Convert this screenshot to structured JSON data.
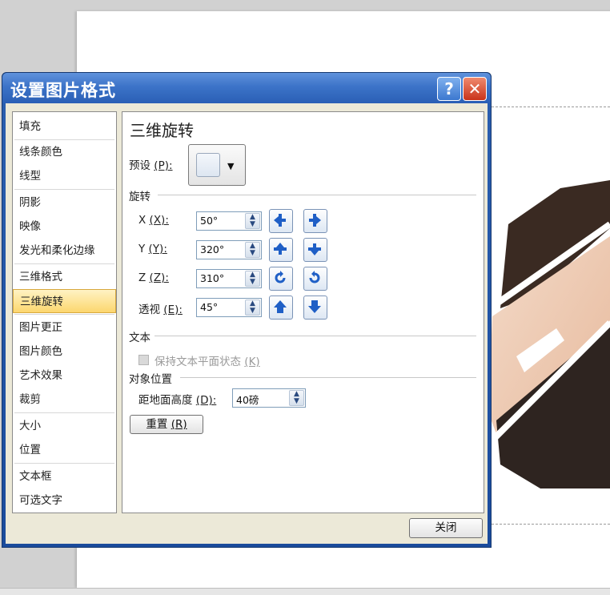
{
  "dialog": {
    "title": "设置图片格式",
    "help_label": "?",
    "close_label": "✕",
    "close_button_label": "关闭"
  },
  "nav": {
    "items": [
      {
        "label": "填充"
      },
      {
        "label": "线条颜色"
      },
      {
        "label": "线型"
      },
      {
        "label": "阴影"
      },
      {
        "label": "映像"
      },
      {
        "label": "发光和柔化边缘"
      },
      {
        "label": "三维格式"
      },
      {
        "label": "三维旋转"
      },
      {
        "label": "图片更正"
      },
      {
        "label": "图片颜色"
      },
      {
        "label": "艺术效果"
      },
      {
        "label": "裁剪"
      },
      {
        "label": "大小"
      },
      {
        "label": "位置"
      },
      {
        "label": "文本框"
      },
      {
        "label": "可选文字"
      }
    ],
    "active": "三维旋转"
  },
  "panel": {
    "title": "三维旋转",
    "preset_label": "预设",
    "preset_key": "(P):",
    "rotation_group": "旋转",
    "x_label": "X",
    "x_key": "(X):",
    "x_value": "50°",
    "y_label": "Y",
    "y_key": "(Y):",
    "y_value": "320°",
    "z_label": "Z",
    "z_key": "(Z):",
    "z_value": "310°",
    "perspective_label": "透视",
    "perspective_key": "(E):",
    "perspective_value": "45°",
    "text_group": "文本",
    "keep_text_flat_label": "保持文本平面状态",
    "keep_text_flat_key": "(K)",
    "object_position_group": "对象位置",
    "distance_label": "距地面高度",
    "distance_key": "(D):",
    "distance_value": "40磅",
    "reset_label": "重置",
    "reset_key": "(R)"
  },
  "icons": {
    "help": "help-icon",
    "close": "close-icon",
    "spin": "spin-arrows-icon",
    "rotate_left": "rotate-left-icon",
    "rotate_right": "rotate-right-icon",
    "rotate_up": "rotate-up-icon",
    "rotate_down": "rotate-down-icon",
    "rotate_ccw": "rotate-counterclockwise-icon",
    "rotate_cw": "rotate-clockwise-icon",
    "perspective_narrow": "perspective-narrow-icon",
    "perspective_widen": "perspective-widen-icon"
  },
  "colors": {
    "title_bar": "#3c73c8",
    "active_nav": "#fcd66e",
    "close_button": "#c9331a"
  }
}
